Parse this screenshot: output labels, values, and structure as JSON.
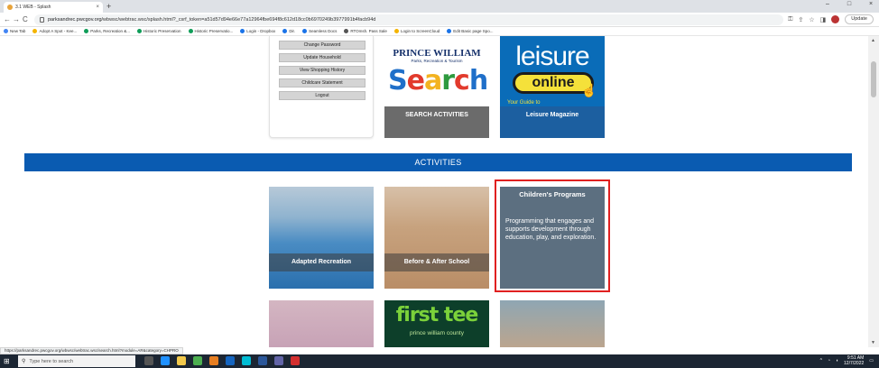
{
  "browser": {
    "tab_title": "3.1 WEB - Splash",
    "tab_close": "×",
    "new_tab": "+",
    "back": "←",
    "forward": "→",
    "reload": "C",
    "url_domain": "parksandrec.pwcgov.org",
    "url_path": "/wbwsc/webtrac.wsc/splash.html?_csrf_token=a51d57d94e66e77a12964fbe694f8c612d18cc0b6970249b3977991b4facb94d",
    "update_label": "Update",
    "window_minimize": "–",
    "window_maximize": "□",
    "window_close": "×",
    "bookmarks": [
      {
        "label": "New Tab",
        "color": "#4285f4"
      },
      {
        "label": "Adopt A Spot - Kee...",
        "color": "#f4b400"
      },
      {
        "label": "Parks, Recreation &...",
        "color": "#0f9d58"
      },
      {
        "label": "Historic Preservation",
        "color": "#0f9d58"
      },
      {
        "label": "Historic Preservatio...",
        "color": "#0f9d58"
      },
      {
        "label": "Login - Dropbox",
        "color": "#1a73e8"
      },
      {
        "label": "Dir.",
        "color": "#1a73e8"
      },
      {
        "label": "Seamless Docs",
        "color": "#1a73e8"
      },
      {
        "label": "RTOmsh. Pass Sale",
        "color": "#555555"
      },
      {
        "label": "Login to ScreenCloud",
        "color": "#f4b400"
      },
      {
        "label": "Edit Basic page Spo...",
        "color": "#1a73e8"
      }
    ]
  },
  "account_menu": {
    "buttons": [
      "Change Password",
      "Update Household",
      "View Shopping History",
      "Childcare Statement",
      "Logout"
    ]
  },
  "promos": {
    "search": {
      "brand_title": "PRINCE WILLIAM",
      "brand_sub": "Parks, Recreation & Tourism",
      "big_word_letters": [
        "S",
        "e",
        "a",
        "r",
        "c",
        "h"
      ],
      "caption": "SEARCH ACTIVITIES"
    },
    "leisure": {
      "word": "leisure",
      "pill": "online",
      "tagline": "Your Guide to",
      "caption": "Leisure Magazine"
    }
  },
  "activities": {
    "heading": "ACTIVITIES",
    "cards": [
      {
        "label": "Adapted Recreation"
      },
      {
        "label": "Before & After School"
      },
      {
        "label": "Children's Programs",
        "description": "Programming that engages and supports development through education, play, and exploration."
      }
    ],
    "first_tee_main": "first tee",
    "first_tee_sub": "prince william county"
  },
  "status_bar_url": "https://parksandrec.pwcgov.org/wbwsc/webtrac.wsc/search.html?module=AR&category=CHPRO",
  "taskbar": {
    "search_placeholder": "Type here to search",
    "time": "9:51 AM",
    "date": "12/7/2022"
  },
  "colors": {
    "activities_bar": "#0a5bb1",
    "highlight_border": "#e02020",
    "leisure_blue": "#0a6cb8",
    "online_yellow": "#f5e13a"
  }
}
